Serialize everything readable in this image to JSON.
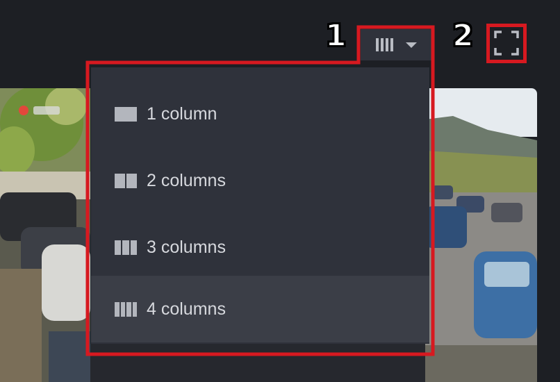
{
  "toolbar": {
    "layout_button_icon": "four-columns-icon",
    "dropdown_caret_icon": "caret-down-icon",
    "fullscreen_icon": "fullscreen-icon"
  },
  "layout_menu": {
    "items": [
      {
        "label": "1 column",
        "icon": "one-column-icon",
        "columns": 1
      },
      {
        "label": "2 columns",
        "icon": "two-columns-icon",
        "columns": 2
      },
      {
        "label": "3 columns",
        "icon": "three-columns-icon",
        "columns": 3
      },
      {
        "label": "4 columns",
        "icon": "four-columns-icon",
        "columns": 4,
        "selected": true
      }
    ]
  },
  "annotations": {
    "label_1": "1",
    "label_2": "2",
    "highlight_color": "#d71920"
  },
  "colors": {
    "background": "#1d1f24",
    "menu_background": "#2f323b",
    "menu_selected": "#3b3e47",
    "text": "#d7d9de"
  }
}
